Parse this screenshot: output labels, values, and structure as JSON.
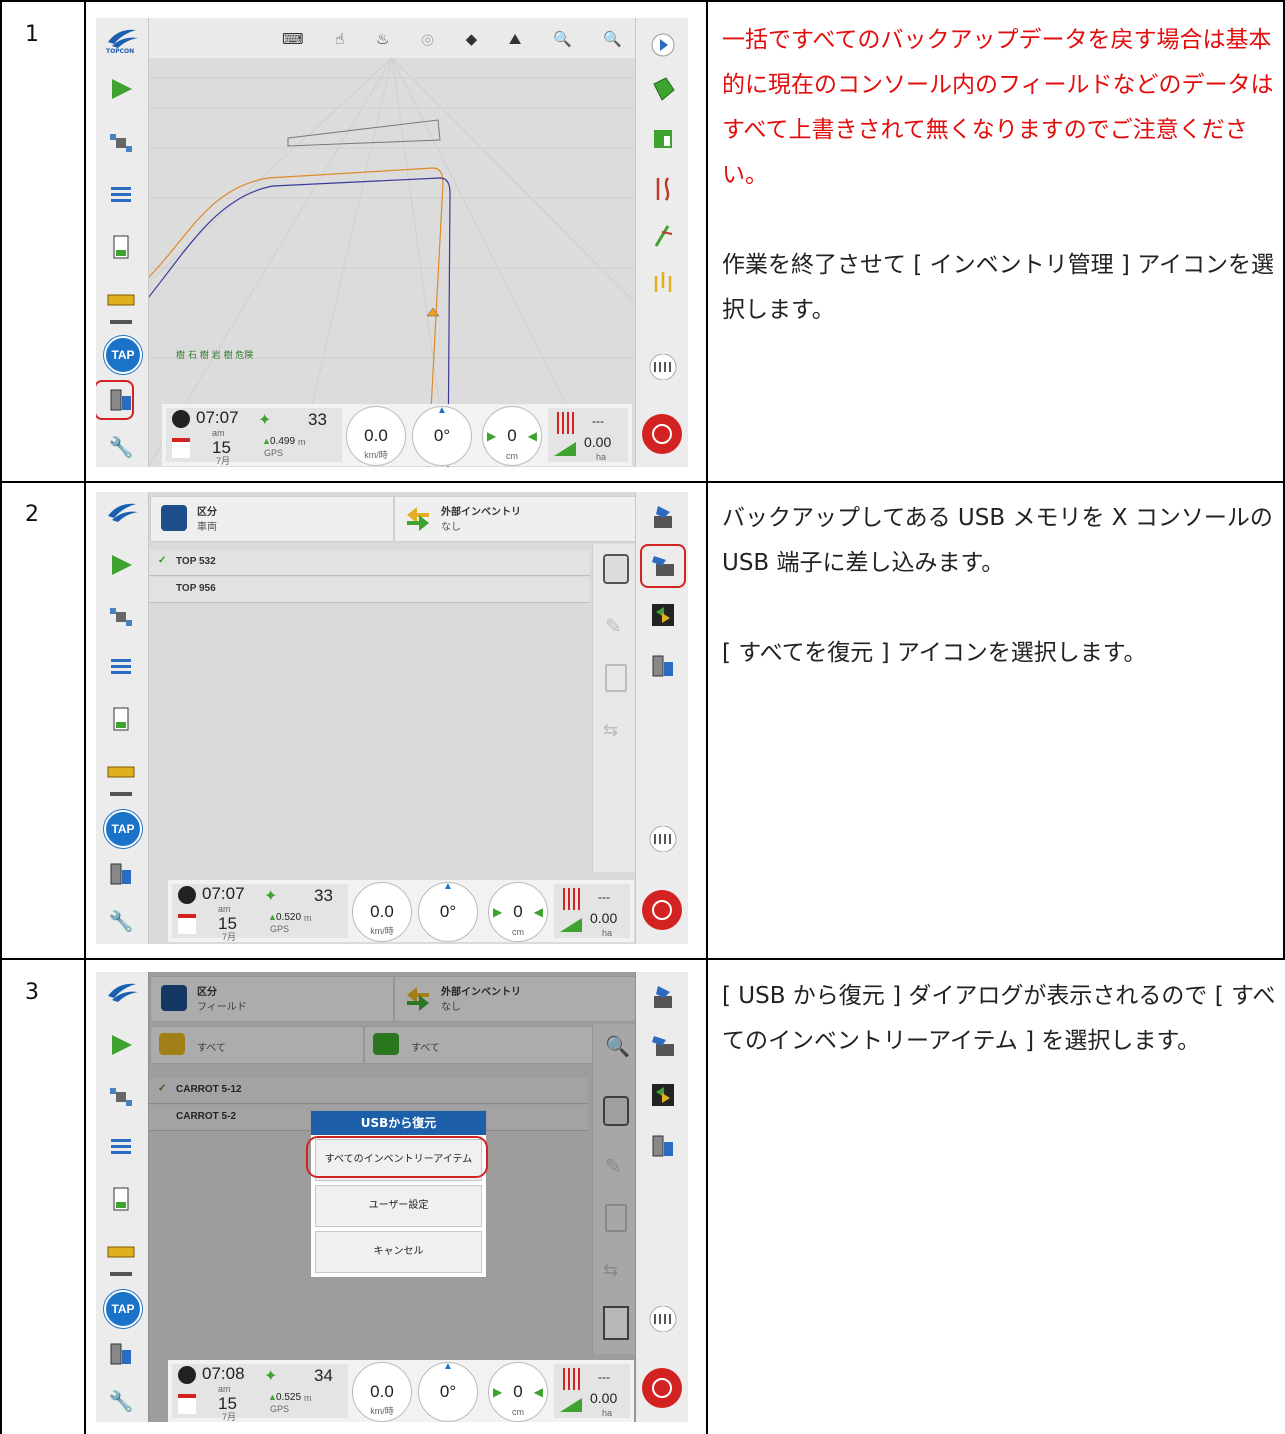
{
  "rows": [
    {
      "num": "1",
      "text_warning": "一括ですべてのバックアップデータを戻す場合は基本的に現在のコンソール内のフィールドなどのデータはすべて上書きされて無くなりますのでご注意ください。",
      "text_main": "作業を終了させて [ インベントリ管理 ] アイコンを選択します。",
      "screen": {
        "logo_label": "TOPCON",
        "tap_label": "TAP",
        "map_labels": "樹 石 樹 岩 樹 危険",
        "status": {
          "time": "07:07",
          "ampm": "am",
          "date": "15",
          "month": "7月",
          "sats": "33",
          "accuracy": "0.499",
          "acc_unit": "m",
          "gps": "GPS",
          "speed": "0.0",
          "speed_unit": "km/時",
          "heading": "0°",
          "offset": "0",
          "offset_unit": "cm",
          "dash": "---",
          "area": "0.00",
          "area_unit": "ha"
        }
      }
    },
    {
      "num": "2",
      "text_main": "バックアップしてある USB メモリを X コンソールの USB 端子に差し込みます。",
      "text_main2": "[ すべてを復元 ] アイコンを選択します。",
      "screen": {
        "tap_label": "TAP",
        "header_left_title": "区分",
        "header_left_sub": "車両",
        "header_right_title": "外部インベントリ",
        "header_right_sub": "なし",
        "items": [
          "TOP 532",
          "TOP 956"
        ],
        "status": {
          "time": "07:07",
          "ampm": "am",
          "date": "15",
          "month": "7月",
          "sats": "33",
          "accuracy": "0.520",
          "acc_unit": "m",
          "gps": "GPS",
          "speed": "0.0",
          "speed_unit": "km/時",
          "heading": "0°",
          "offset": "0",
          "offset_unit": "cm",
          "dash": "---",
          "area": "0.00",
          "area_unit": "ha"
        }
      }
    },
    {
      "num": "3",
      "text_main": "[ USB から復元 ] ダイアログが表示されるので [ すべてのインベントリーアイテム ] を選択します。",
      "screen": {
        "tap_label": "TAP",
        "header_left_title": "区分",
        "header_left_sub": "フィールド",
        "header_right_title": "外部インベントリ",
        "header_right_sub": "なし",
        "filter_left": "すべて",
        "filter_right": "すべて",
        "items": [
          "CARROT 5-12",
          "CARROT 5-2"
        ],
        "dialog_title": "USBから復元",
        "dialog_options": [
          "すべてのインベントリーアイテム",
          "ユーザー設定",
          "キャンセル"
        ],
        "status": {
          "time": "07:08",
          "ampm": "am",
          "date": "15",
          "month": "7月",
          "sats": "34",
          "accuracy": "0.525",
          "acc_unit": "m",
          "gps": "GPS",
          "speed": "0.0",
          "speed_unit": "km/時",
          "heading": "0°",
          "offset": "0",
          "offset_unit": "cm",
          "dash": "---",
          "area": "0.00",
          "area_unit": "ha"
        }
      }
    }
  ],
  "colors": {
    "warning": "#e20d0d",
    "accent_blue": "#1a73c9",
    "highlight": "#d32222"
  }
}
